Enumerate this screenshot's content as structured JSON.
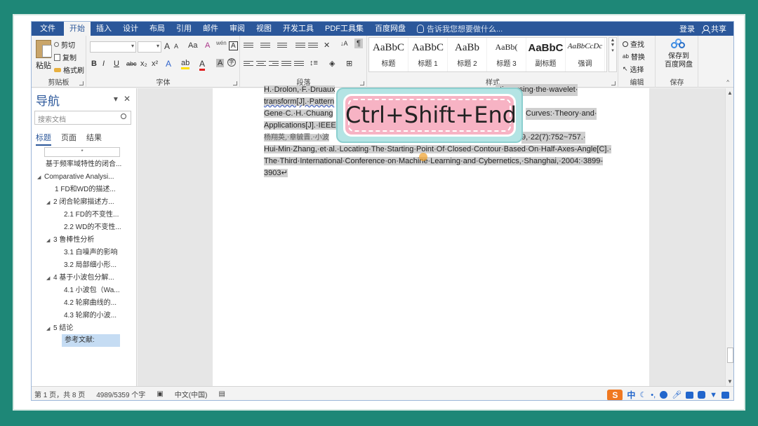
{
  "ribbon_tabs": {
    "file": "文件",
    "home": "开始",
    "insert": "插入",
    "design": "设计",
    "layout": "布局",
    "references": "引用",
    "mailings": "邮件",
    "review": "审阅",
    "view": "视图",
    "developer": "开发工具",
    "pdf": "PDF工具集",
    "baidu": "百度网盘"
  },
  "tell_me": "告诉我您想要做什么...",
  "account": {
    "login": "登录",
    "share": "共享"
  },
  "clipboard": {
    "paste": "粘贴",
    "cut": "剪切",
    "copy": "复制",
    "format_painter": "格式刷",
    "label": "剪贴板"
  },
  "font": {
    "label": "字体",
    "bold": "B",
    "italic": "I",
    "underline": "U",
    "strike": "abc",
    "sub": "x₂",
    "sup": "x²",
    "grow": "A",
    "shrink": "A",
    "case": "Aa",
    "clear": "A",
    "phonetic": "wén",
    "border": "A"
  },
  "paragraph": {
    "label": "段落"
  },
  "styles": {
    "label": "样式",
    "items": [
      {
        "sample": "AaBbC",
        "name": "标题"
      },
      {
        "sample": "AaBbC",
        "name": "标题 1"
      },
      {
        "sample": "AaBb",
        "name": "标题 2"
      },
      {
        "sample": "AaBb(",
        "name": "标题 3"
      },
      {
        "sample": "AaBbC",
        "name": "副标题"
      },
      {
        "sample": "AaBbCcDc",
        "name": "强调"
      }
    ]
  },
  "editing": {
    "label": "编辑",
    "find": "查找",
    "replace": "替换",
    "select": "选择"
  },
  "save": {
    "line1": "保存到",
    "line2": "百度网盘",
    "label": "保存"
  },
  "nav": {
    "title": "导航",
    "search_placeholder": "搜索文档",
    "tabs": {
      "headings": "标题",
      "pages": "页面",
      "results": "结果"
    },
    "field": "*",
    "headings": [
      {
        "text": "基于频率域特性的闭合..."
      },
      {
        "text": "Comparative Analysi..."
      },
      {
        "text": "1 FD和WD的描述..."
      },
      {
        "text": "2 闭合轮廓描述方..."
      },
      {
        "text": "2.1 FD的不变性..."
      },
      {
        "text": "2.2 WD的不变性..."
      },
      {
        "text": "3 鲁棒性分析"
      },
      {
        "text": "3.1 白噪声的影响"
      },
      {
        "text": "3.2 局部细小形..."
      },
      {
        "text": "4 基于小波包分解..."
      },
      {
        "text": "4.1 小波包（Wa..."
      },
      {
        "text": "4.2 轮廓曲线的..."
      },
      {
        "text": "4.3 轮廓的小波..."
      },
      {
        "text": "5 结论"
      },
      {
        "text": "参考文献:"
      }
    ]
  },
  "document": {
    "lines": [
      {
        "text": "H.·Drolon,·F.·Druaux",
        "tail": "ation·using·the·wavelet·"
      },
      {
        "text": "transform[J].·Pattern",
        "tail": ""
      },
      {
        "text": "Gene·C.·H.·Chuang",
        "tail": "Curves:·Theory·and·"
      },
      {
        "text": "Applications[J].·IEEE",
        "tail": ""
      },
      {
        "text": "杨翔英,·章毓晋.·小波",
        "tail": "9,·22(7):752~757.·"
      },
      {
        "text": "Hui-Min·Zhang,·et·al.·Locating·The·Starting·Point·Of·Closed·Contour·Based·On·Half-Axes-Angle[C].·",
        "tail": ""
      },
      {
        "text": "The·Third·International·Conference·on·Machine·Learning·and·Cybernetics,·Shanghai,·2004:·3899-",
        "tail": ""
      },
      {
        "text": "3903↵",
        "tail": ""
      }
    ]
  },
  "shortcut": "Ctrl+Shift+End",
  "status": {
    "page": "第 1 页，共 8 页",
    "words": "4989/5359 个字",
    "lang": "中文(中国)"
  },
  "ime": {
    "logo": "S",
    "mode": "中"
  }
}
